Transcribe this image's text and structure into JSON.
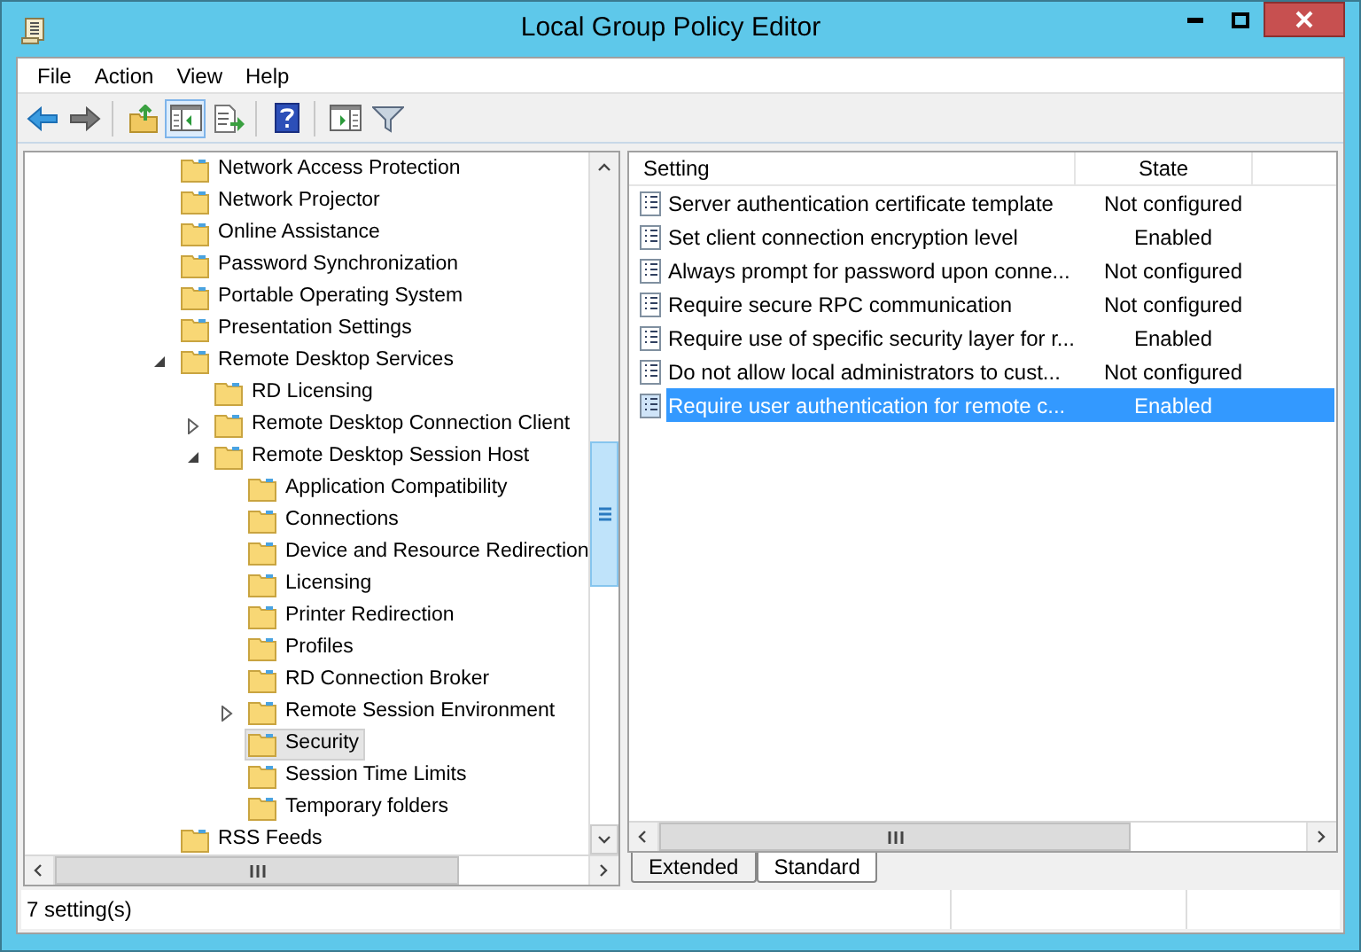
{
  "window": {
    "title": "Local Group Policy Editor"
  },
  "menu": [
    "File",
    "Action",
    "View",
    "Help"
  ],
  "toolbar": [
    {
      "kind": "back",
      "selected": false
    },
    {
      "kind": "forward",
      "selected": false
    },
    {
      "kind": "up",
      "selected": false
    },
    {
      "kind": "tree",
      "selected": true
    },
    {
      "kind": "export",
      "selected": false
    },
    {
      "kind": "help",
      "selected": false
    },
    {
      "kind": "properties",
      "selected": false
    },
    {
      "kind": "filter",
      "selected": false
    }
  ],
  "tree": [
    {
      "label": "Network Access Protection",
      "selected": false
    },
    {
      "label": "Network Projector",
      "selected": false
    },
    {
      "label": "Online Assistance",
      "selected": false
    },
    {
      "label": "Password Synchronization",
      "selected": false
    },
    {
      "label": "Portable Operating System",
      "selected": false
    },
    {
      "label": "Presentation Settings",
      "selected": false
    },
    {
      "label": "Remote Desktop Services",
      "selected": false,
      "expanded": true,
      "children": [
        {
          "label": "RD Licensing",
          "selected": false
        },
        {
          "label": "Remote Desktop Connection Client",
          "selected": false,
          "expanded": false
        },
        {
          "label": "Remote Desktop Session Host",
          "selected": false,
          "expanded": true,
          "children": [
            {
              "label": "Application Compatibility",
              "selected": false
            },
            {
              "label": "Connections",
              "selected": false
            },
            {
              "label": "Device and Resource Redirection",
              "selected": false
            },
            {
              "label": "Licensing",
              "selected": false
            },
            {
              "label": "Printer Redirection",
              "selected": false
            },
            {
              "label": "Profiles",
              "selected": false
            },
            {
              "label": "RD Connection Broker",
              "selected": false
            },
            {
              "label": "Remote Session Environment",
              "selected": false,
              "expanded": false
            },
            {
              "label": "Security",
              "selected": true
            },
            {
              "label": "Session Time Limits",
              "selected": false
            },
            {
              "label": "Temporary folders",
              "selected": false
            }
          ]
        }
      ]
    },
    {
      "label": "RSS Feeds",
      "selected": false
    }
  ],
  "table": {
    "columns": [
      "Setting",
      "State"
    ],
    "rows": [
      {
        "setting": "Server authentication certificate template",
        "state": "Not configured",
        "selected": false
      },
      {
        "setting": "Set client connection encryption level",
        "state": "Enabled",
        "selected": false
      },
      {
        "setting": "Always prompt for password upon conne...",
        "state": "Not configured",
        "selected": false
      },
      {
        "setting": "Require secure RPC communication",
        "state": "Not configured",
        "selected": false
      },
      {
        "setting": "Require use of specific security layer for r...",
        "state": "Enabled",
        "selected": false
      },
      {
        "setting": "Do not allow local administrators to cust...",
        "state": "Not configured",
        "selected": false
      },
      {
        "setting": "Require user authentication for remote c...",
        "state": "Enabled",
        "selected": true
      }
    ]
  },
  "tabs": [
    {
      "label": "Extended",
      "selected": false
    },
    {
      "label": "Standard",
      "selected": true
    }
  ],
  "status_bar": "7 setting(s)"
}
